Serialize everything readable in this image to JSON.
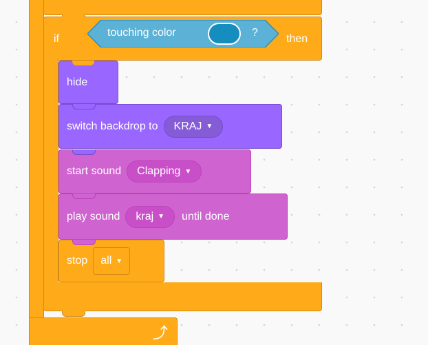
{
  "if_block": {
    "if_label": "if",
    "then_label": "then",
    "condition": {
      "label": "touching color",
      "question": "?",
      "color": "#168dbf"
    }
  },
  "blocks": {
    "hide": {
      "label": "hide"
    },
    "switch_backdrop": {
      "label": "switch backdrop to",
      "value": "KRAJ"
    },
    "start_sound": {
      "label": "start sound",
      "value": "Clapping"
    },
    "play_sound": {
      "label": "play sound",
      "value": "kraj",
      "suffix": "until done"
    },
    "stop": {
      "label": "stop",
      "value": "all"
    }
  },
  "icons": {
    "dropdown_caret": "▼",
    "loop_arrow": "⤴"
  },
  "colors": {
    "control": "#ffab19",
    "looks": "#9966ff",
    "sound": "#cf63cf",
    "sensing": "#5cb1d6"
  }
}
